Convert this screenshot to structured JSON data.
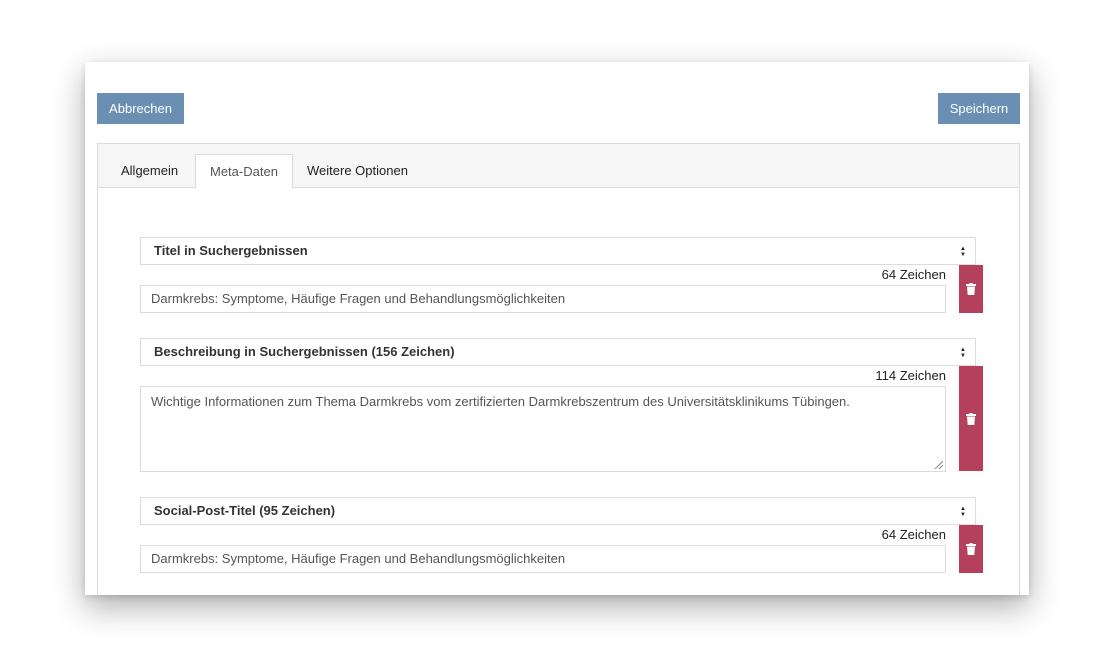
{
  "toolbar": {
    "cancel_label": "Abbrechen",
    "save_label": "Speichern"
  },
  "tabs": [
    {
      "label": "Allgemein",
      "active": false
    },
    {
      "label": "Meta-Daten",
      "active": true
    },
    {
      "label": "Weitere Optionen",
      "active": false
    }
  ],
  "fields": [
    {
      "select_label": "Titel in Suchergebnissen",
      "counter": "64 Zeichen",
      "value": "Darmkrebs: Symptome, Häufige Fragen und Behandlungsmöglichkeiten"
    },
    {
      "select_label": "Beschreibung in Suchergebnissen (156 Zeichen)",
      "counter": "114 Zeichen",
      "value": "Wichtige Informationen zum Thema Darmkrebs vom zertifizierten Darmkrebszentrum des Universitätsklinikums Tübingen."
    },
    {
      "select_label": "Social-Post-Titel (95 Zeichen)",
      "counter": "64 Zeichen",
      "value": "Darmkrebs: Symptome, Häufige Fragen und Behandlungsmöglichkeiten"
    }
  ],
  "colors": {
    "button": "#6b8fb2",
    "delete": "#b5405c"
  },
  "icons": {
    "select_arrows": "sort-arrows-icon",
    "delete": "trash-icon"
  }
}
